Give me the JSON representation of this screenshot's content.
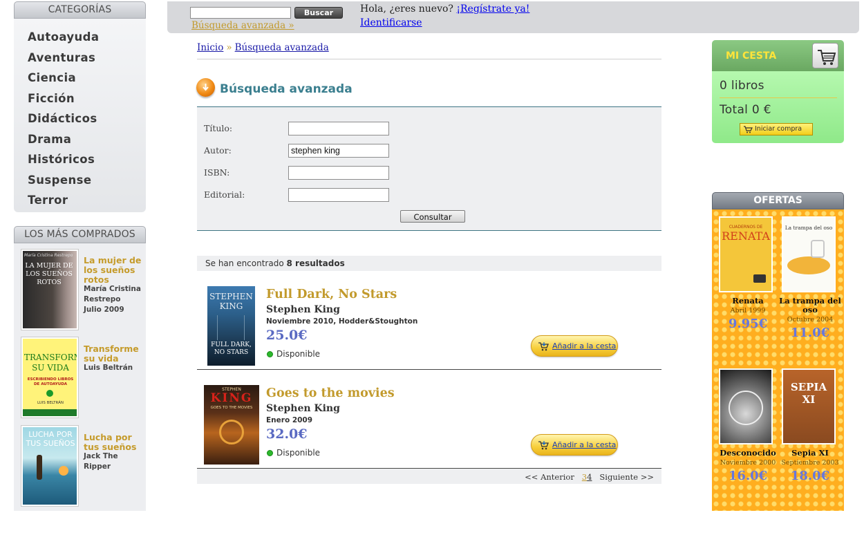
{
  "sidebar": {
    "categories_title": "CATEGORÍAS",
    "categories": [
      "Autoayuda",
      "Aventuras",
      "Ciencia",
      "Ficción",
      "Didácticos",
      "Drama",
      "Históricos",
      "Suspense",
      "Terror"
    ],
    "bestsellers_title": "LOS MÁS COMPRADOS",
    "bestsellers": [
      {
        "title": "La mujer de los sueños rotos",
        "author": "María Cristina Restrepo",
        "date": "Julio 2009",
        "cover_text": "LA MUJER DE LOS SUEÑOS ROTOS",
        "cover_top": "María Cristina Restrepo"
      },
      {
        "title": "Transforme su vida",
        "author": "Luis Beltrán",
        "cover_text": "TRANSFORME SU VIDA",
        "cover_sub": "ESCRIBIENDO LIBROS DE AUTOAYUDA",
        "cover_top": "",
        "cover_bottom": "LUIS BELTRÁN"
      },
      {
        "title": "Lucha por tus sueños",
        "author": "Jack The Ripper",
        "cover_text": "LUCHA POR TUS SUEÑOS",
        "cover_top": "",
        "cover_bottom": ""
      }
    ]
  },
  "topbar": {
    "search_button": "Buscar",
    "search_value": "",
    "advanced_link": "Búsqueda avanzada »",
    "greeting": "Hola, ¿eres nuevo?",
    "register_link": "¡Regístrate ya!",
    "login_link": "Identificarse"
  },
  "breadcrumb": {
    "home": "Inicio",
    "separator": "»",
    "current": "Búsqueda avanzada"
  },
  "page_title": "Búsqueda avanzada",
  "form": {
    "title_label": "Título:",
    "title_value": "",
    "author_label": "Autor:",
    "author_value": "stephen king",
    "isbn_label": "ISBN:",
    "isbn_value": "",
    "publisher_label": "Editorial:",
    "publisher_value": "",
    "submit": "Consultar"
  },
  "results": {
    "summary_prefix": "Se han encontrado",
    "count": "8 resultados",
    "items": [
      {
        "title": "Full Dark, No Stars",
        "author": "Stephen King",
        "publication": "Noviembre 2010, Hodder&Stoughton",
        "price": "25.0€",
        "availability": "Disponible",
        "add_label": "Añadir a la cesta",
        "cover_author": "STEPHEN KING",
        "cover_title": "FULL DARK, NO STARS"
      },
      {
        "title": "Goes to the movies",
        "author": "Stephen King",
        "publication": "Enero 2009",
        "price": "32.0€",
        "availability": "Disponible",
        "add_label": "Añadir a la cesta",
        "cover_author": "KING",
        "cover_title": "GOES TO THE MOVIES"
      }
    ],
    "pager": {
      "prev": "<< Anterior",
      "pages": [
        "3",
        "4"
      ],
      "current_page": "3",
      "next": "Siguiente >>"
    }
  },
  "cart": {
    "title": "MI CESTA",
    "books": "0 libros",
    "total": "Total 0 €",
    "start_button": "Iniciar compra"
  },
  "offers": {
    "title": "OFERTAS",
    "items": [
      {
        "title": "Renata",
        "date": "Abril 1999",
        "price": "9.95€",
        "cover_text": "RENATA",
        "cover_sub": "CUADERNOS DE"
      },
      {
        "title": "La trampa del oso",
        "date": "Octubre 2004",
        "price": "11.0€",
        "cover_text": "La trampa del oso"
      },
      {
        "title": "Desconocido",
        "date": "Noviembre 2000",
        "price": "16.0€"
      },
      {
        "title": "Sepia XI",
        "date": "Septiembre 2003",
        "price": "18.0€",
        "cover_text": "SEPIA XI"
      }
    ]
  },
  "colors": {
    "accent_gold": "#c29a2c",
    "link_blue": "#0000ee",
    "price_blue": "#5a6ac2",
    "offers_orange": "#ffae1f",
    "cart_green": "#8fe989"
  }
}
